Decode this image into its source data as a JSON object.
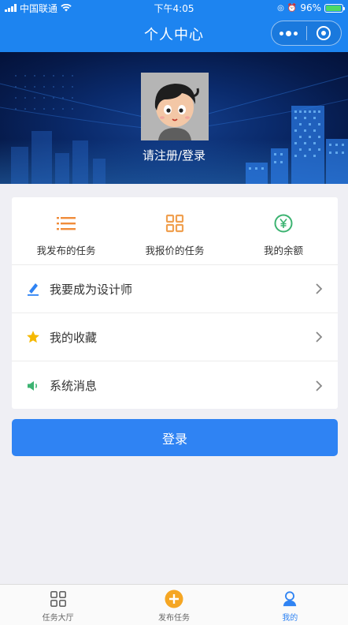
{
  "status_bar": {
    "carrier": "中国联通",
    "time": "下午4:05",
    "battery_percent": "96%",
    "battery_level": 0.96
  },
  "nav": {
    "title": "个人中心"
  },
  "profile": {
    "login_hint": "请注册/登录"
  },
  "quick_actions": [
    {
      "label": "我发布的任务",
      "icon": "list-icon",
      "color": "#f08c3a"
    },
    {
      "label": "我报价的任务",
      "icon": "grid-icon",
      "color": "#f0a050"
    },
    {
      "label": "我的余额",
      "icon": "yen-circle-icon",
      "color": "#3cb371"
    }
  ],
  "menu": [
    {
      "label": "我要成为设计师",
      "icon": "pen-icon",
      "color": "#2f83f3"
    },
    {
      "label": "我的收藏",
      "icon": "star-icon",
      "color": "#f5b800"
    },
    {
      "label": "系统消息",
      "icon": "speaker-icon",
      "color": "#3cb371"
    }
  ],
  "login_button": {
    "label": "登录"
  },
  "tab_bar": {
    "tabs": [
      {
        "label": "任务大厅",
        "icon": "grid-icon",
        "active": false
      },
      {
        "label": "发布任务",
        "icon": "plus-circle-icon",
        "active": false
      },
      {
        "label": "我的",
        "icon": "user-icon",
        "active": true
      }
    ]
  },
  "colors": {
    "primary": "#1d84f0",
    "button": "#2f83f3",
    "background": "#efeff4"
  }
}
